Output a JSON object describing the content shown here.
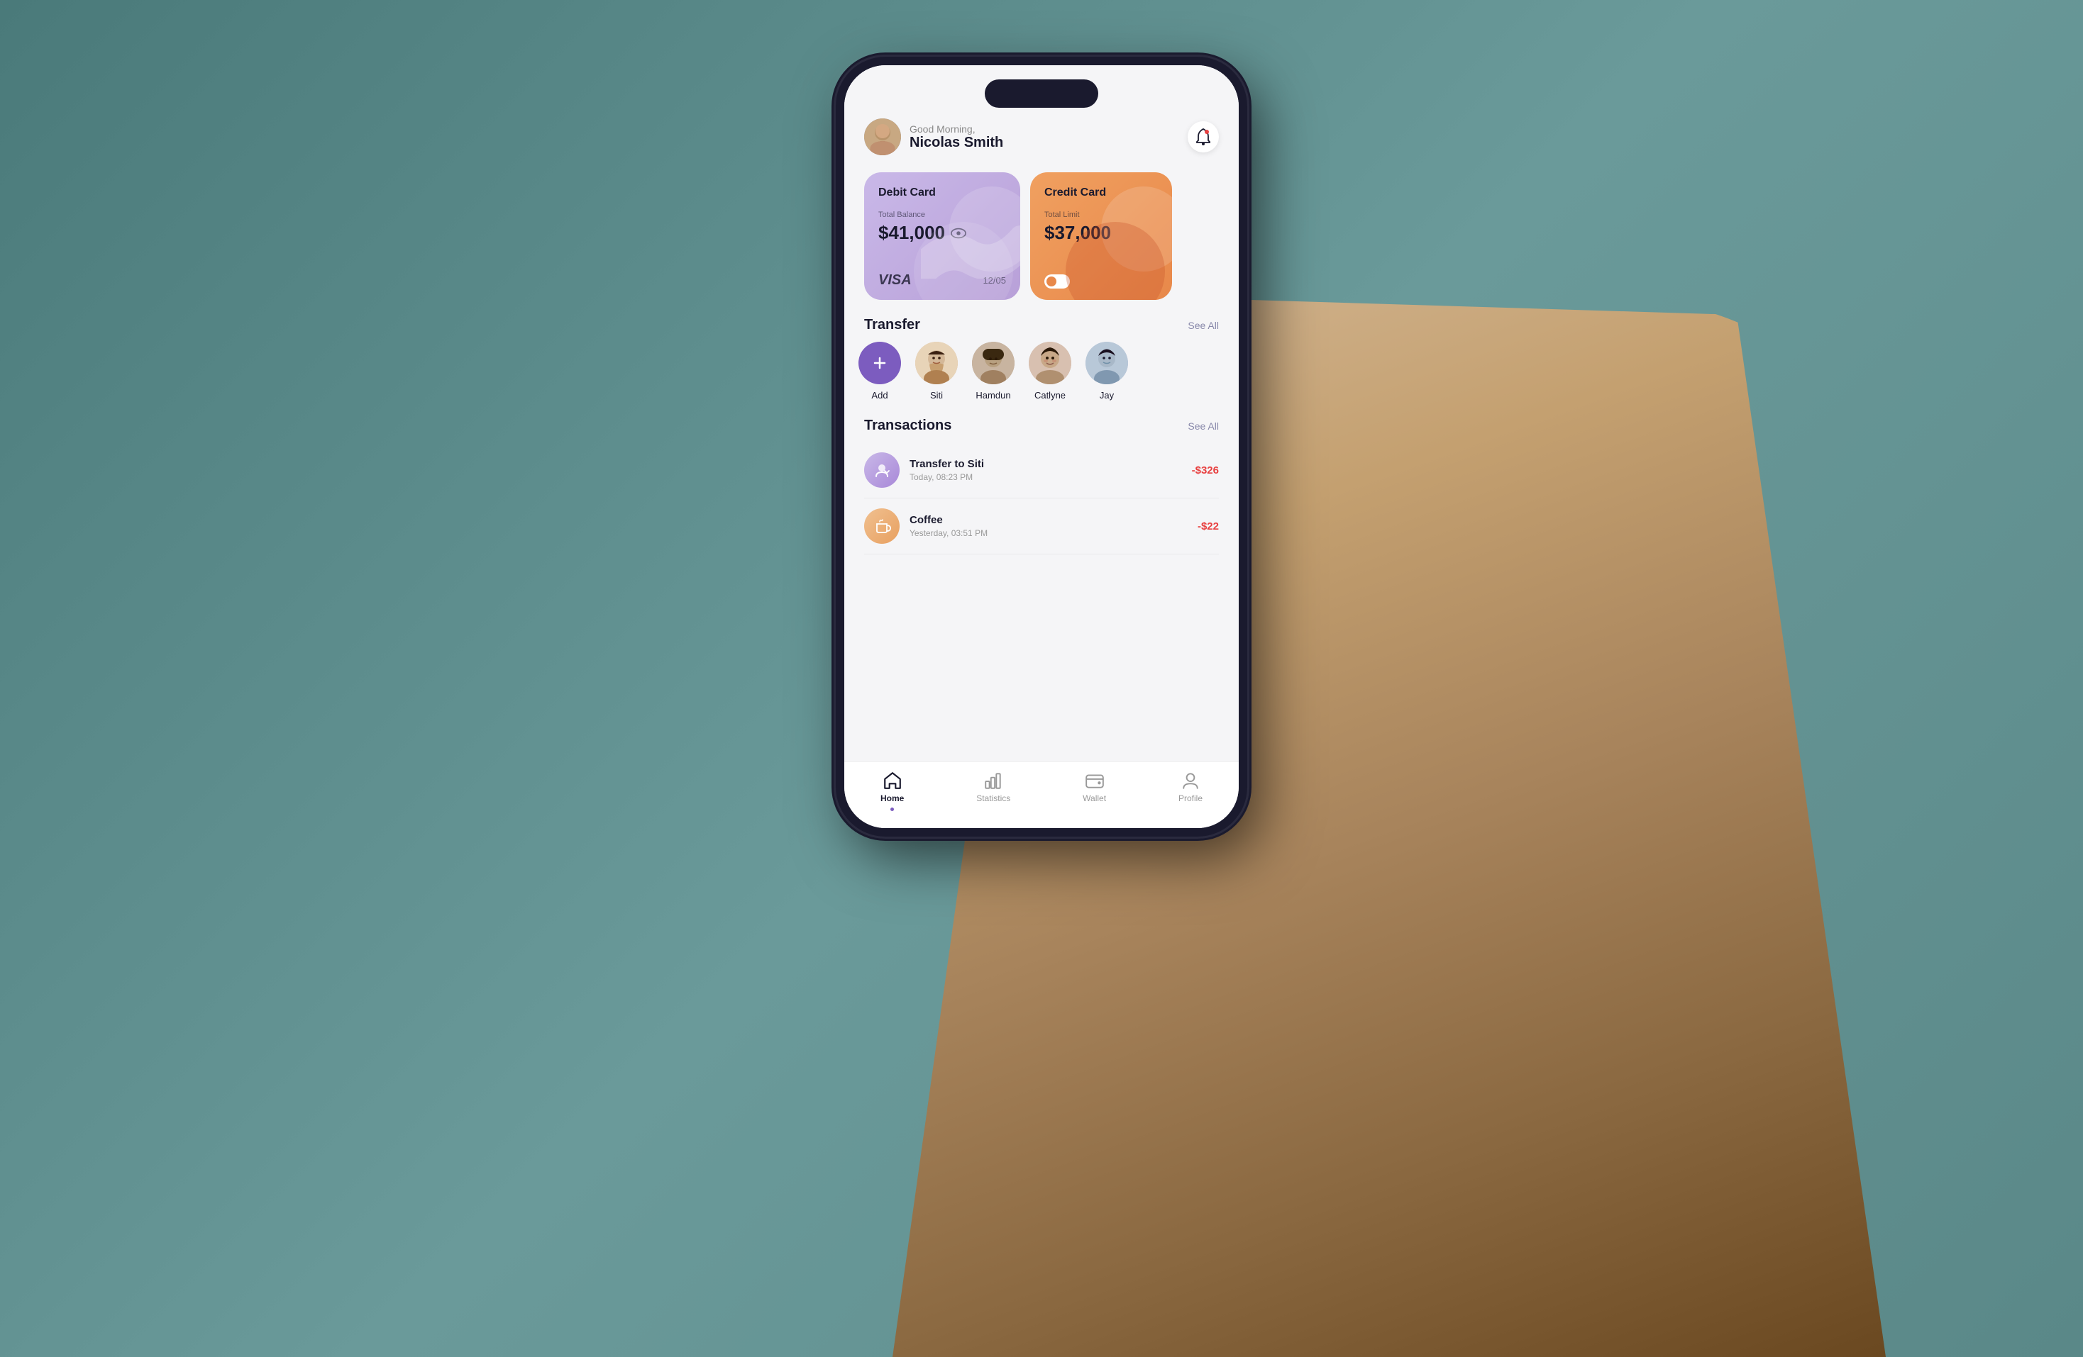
{
  "scene": {
    "bg_color": "#5a8a8a"
  },
  "header": {
    "greeting": "Good Morning,",
    "user_name": "Nicolas Smith",
    "notification_icon": "bell-icon"
  },
  "cards": [
    {
      "type": "Debit Card",
      "balance_label": "Total Balance",
      "balance": "$41,000",
      "brand": "VISA",
      "expiry": "12/05"
    },
    {
      "type": "Credit Card",
      "limit_label": "Total Limit",
      "limit": "$37,000"
    }
  ],
  "transfer": {
    "section_title": "Transfer",
    "see_all": "See All",
    "contacts": [
      {
        "name": "Add",
        "type": "add-button"
      },
      {
        "name": "Siti",
        "color": "#e8d4b0"
      },
      {
        "name": "Hamdun",
        "color": "#c8b090"
      },
      {
        "name": "Catlyne",
        "color": "#d8b0a0"
      },
      {
        "name": "Jay",
        "color": "#b0c0d8"
      }
    ]
  },
  "transactions": {
    "section_title": "Transactions",
    "see_all": "See All",
    "items": [
      {
        "name": "Transfer to Siti",
        "date": "Today, 08:23 PM",
        "amount": "-$326",
        "icon_type": "transfer"
      },
      {
        "name": "Coffee",
        "date": "Yesterday, 03:51 PM",
        "amount": "-$22",
        "icon_type": "coffee"
      }
    ]
  },
  "bottom_nav": {
    "items": [
      {
        "label": "Home",
        "icon": "home-icon",
        "active": true
      },
      {
        "label": "Statistics",
        "icon": "statistics-icon",
        "active": false
      },
      {
        "label": "Wallet",
        "icon": "wallet-icon",
        "active": false
      },
      {
        "label": "Profile",
        "icon": "profile-icon",
        "active": false
      }
    ]
  }
}
